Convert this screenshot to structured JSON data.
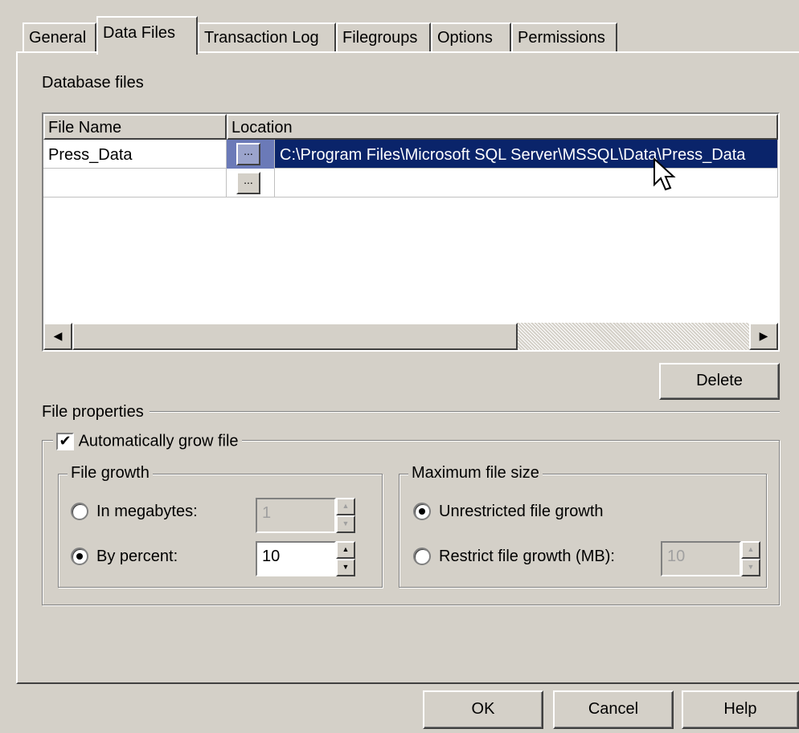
{
  "tabs": [
    {
      "label": "General",
      "active": false
    },
    {
      "label": "Data Files",
      "active": true
    },
    {
      "label": "Transaction Log",
      "active": false
    },
    {
      "label": "Filegroups",
      "active": false
    },
    {
      "label": "Options",
      "active": false
    },
    {
      "label": "Permissions",
      "active": false
    }
  ],
  "database_files": {
    "label": "Database files",
    "columns": [
      "File Name",
      "Location"
    ],
    "rows": [
      {
        "file_name": "Press_Data",
        "location": "C:\\Program Files\\Microsoft SQL Server\\MSSQL\\Data\\Press_Data",
        "selected": true
      },
      {
        "file_name": "",
        "location": "",
        "selected": false
      }
    ],
    "browse_label": "...",
    "delete_label": "Delete"
  },
  "file_properties": {
    "label": "File properties",
    "auto_grow": {
      "label": "Automatically grow file",
      "checked": true,
      "check_glyph": "✔"
    },
    "file_growth": {
      "label": "File growth",
      "in_megabytes": {
        "label": "In megabytes:",
        "selected": false,
        "value": "1"
      },
      "by_percent": {
        "label": "By percent:",
        "selected": true,
        "value": "10"
      }
    },
    "max_file_size": {
      "label": "Maximum file size",
      "unrestricted": {
        "label": "Unrestricted file growth",
        "selected": true
      },
      "restrict": {
        "label": "Restrict file growth (MB):",
        "selected": false,
        "value": "10"
      }
    }
  },
  "buttons": {
    "ok": "OK",
    "cancel": "Cancel",
    "help": "Help"
  },
  "icons": {
    "scroll_left": "◀",
    "scroll_right": "▶",
    "spin_up": "▲",
    "spin_down": "▼"
  },
  "colors": {
    "dialog_bg": "#d4d0c8",
    "selection": "#0a246a"
  }
}
